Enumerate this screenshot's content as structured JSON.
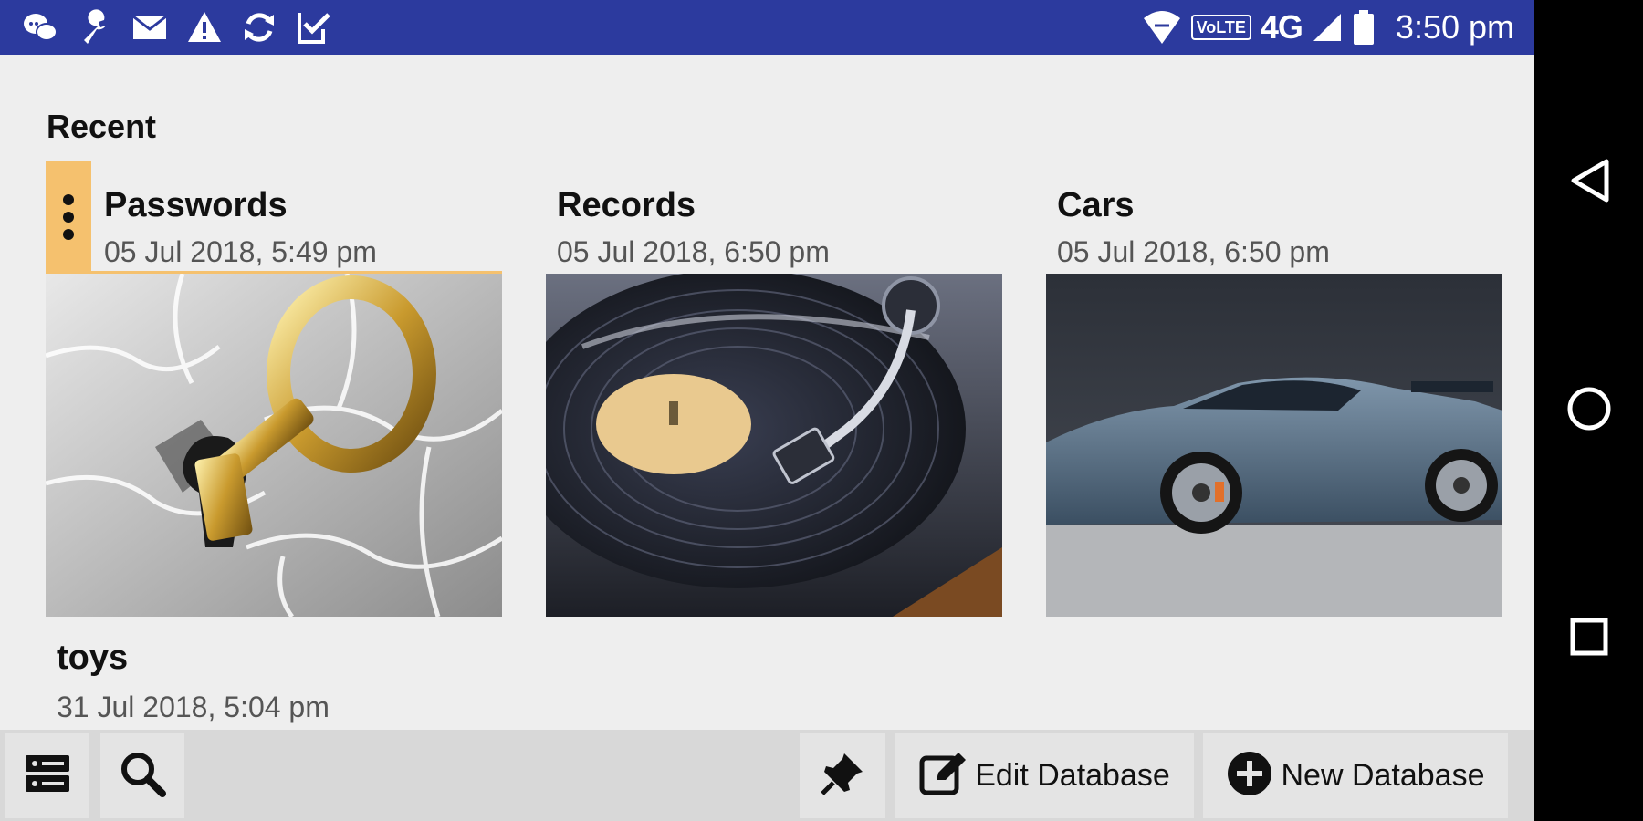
{
  "status_bar": {
    "left_icons": [
      "chat-bubbles-icon",
      "wrench-icon",
      "mail-icon",
      "warning-icon",
      "sync-icon",
      "checkbox-flag-icon"
    ],
    "volte": "VoLTE",
    "network": "4G",
    "time": "3:50 pm"
  },
  "recent": {
    "title": "Recent",
    "cards": [
      {
        "name": "Passwords",
        "date": "05 Jul 2018, 5:49 pm",
        "image": "golden-key-puzzle-image",
        "selected": true
      },
      {
        "name": "Records",
        "date": "05 Jul 2018, 6:50 pm",
        "image": "vinyl-turntable-image",
        "selected": false
      },
      {
        "name": "Cars",
        "date": "05 Jul 2018, 6:50 pm",
        "image": "sports-car-image",
        "selected": false
      }
    ],
    "extra": {
      "name": "toys",
      "date": "31 Jul 2018, 5:04 pm"
    }
  },
  "toolbar": {
    "edit_label": "Edit Database",
    "new_label": "New Database",
    "icons": [
      "database-list-icon",
      "search-icon",
      "pin-icon",
      "edit-icon",
      "add-circle-icon"
    ]
  },
  "nav": {
    "icons": [
      "back-icon",
      "home-icon",
      "recents-icon"
    ]
  },
  "colors": {
    "status_bar": "#2c3a9e",
    "accent": "#f5c16e",
    "background": "#eeeeee"
  }
}
